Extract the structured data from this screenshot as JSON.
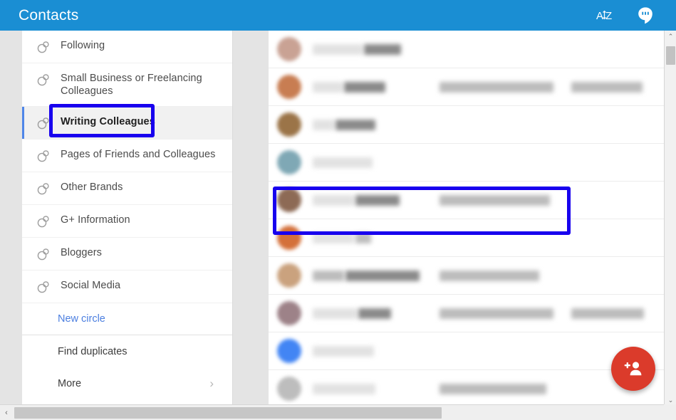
{
  "appbar": {
    "title": "Contacts",
    "sort_icon": "sort-alpha-icon",
    "sort_label": "AZ",
    "hangouts_icon": "hangouts-icon"
  },
  "sidebar": {
    "circles": [
      {
        "label": "Following",
        "icon": "circles-icon",
        "selected": false
      },
      {
        "label": "Small Business or Freelancing Colleagues",
        "icon": "circles-icon",
        "selected": false
      },
      {
        "label": "Writing Colleagues",
        "icon": "circles-icon",
        "selected": true
      },
      {
        "label": "Pages of Friends and Colleagues",
        "icon": "circles-icon",
        "selected": false
      },
      {
        "label": "Other Brands",
        "icon": "circles-icon",
        "selected": false
      },
      {
        "label": "G+ Information",
        "icon": "circles-icon",
        "selected": false
      },
      {
        "label": "Bloggers",
        "icon": "circles-icon",
        "selected": false
      },
      {
        "label": "Social Media",
        "icon": "circles-icon",
        "selected": false
      }
    ],
    "new_circle": "New circle",
    "find_duplicates": "Find duplicates",
    "more": "More",
    "more_chevron": "›",
    "selected_accent": "#4f86e8",
    "link_color": "#4c7fe0"
  },
  "annotations": {
    "highlight_color": "#1800EE",
    "sidebar_target": "Writing Colleagues",
    "row_target": "contact-row-5"
  },
  "contacts": {
    "rows": [
      {
        "avatar_color": "#c9a294",
        "name_redacted": true,
        "name_w1": 70,
        "name_w2": 52,
        "email_w": 0,
        "phone_w": 0
      },
      {
        "avatar_color": "#c87d52",
        "name_redacted": true,
        "name_w1": 42,
        "name_w2": 58,
        "email_w": 160,
        "phone_w": 100
      },
      {
        "avatar_color": "#9b7448",
        "name_redacted": true,
        "name_w1": 30,
        "name_w2": 56,
        "email_w": 0,
        "phone_w": 0
      },
      {
        "avatar_color": "#7fa8b5",
        "name_redacted": true,
        "name_w1": 84,
        "name_w2": 0,
        "email_w": 0,
        "phone_w": 0
      },
      {
        "avatar_color": "#8d6a55",
        "name_redacted": true,
        "name_w1": 58,
        "name_w2": 62,
        "email_w": 155,
        "phone_w": 0
      },
      {
        "avatar_color": "#d4703a",
        "name_redacted": true,
        "name_w1": 58,
        "name_w2": 22,
        "email_w": 0,
        "phone_w": 0
      },
      {
        "avatar_color": "#caa27e",
        "name_redacted": true,
        "name_w1": 44,
        "name_w2": 104,
        "email_w": 140,
        "phone_w": 0
      },
      {
        "avatar_color": "#9d8288",
        "name_redacted": true,
        "name_w1": 62,
        "name_w2": 46,
        "email_w": 160,
        "phone_w": 102
      },
      {
        "avatar_color": "#4285f4",
        "name_redacted": true,
        "name_w1": 86,
        "name_w2": 0,
        "email_w": 0,
        "phone_w": 0
      },
      {
        "avatar_color": "#bdbdbd",
        "name_redacted": true,
        "name_w1": 88,
        "name_w2": 0,
        "email_w": 150,
        "phone_w": 0
      }
    ]
  },
  "fab": {
    "icon": "add-person-icon",
    "color": "#DB3B2B"
  },
  "scrollbars": {
    "vertical": {
      "up": "⌃",
      "down": "⌄"
    },
    "horizontal": {
      "left": "‹",
      "right": "›"
    }
  }
}
